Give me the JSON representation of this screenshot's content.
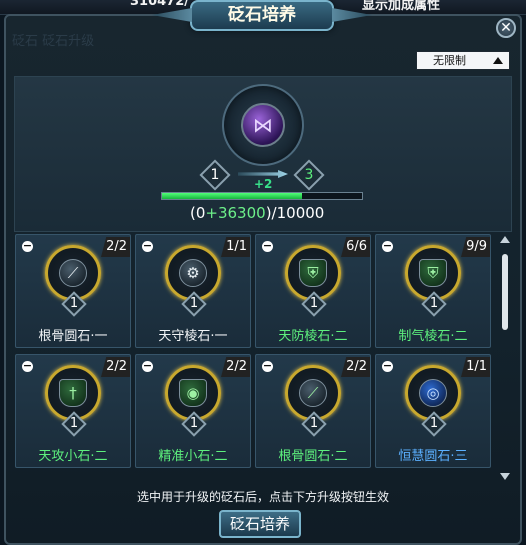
{
  "topbar": {
    "left_number": "310472/",
    "right_text": "显示加成属性"
  },
  "window": {
    "title": "砭石培养"
  },
  "tabs_hint": "砭石  砭石升级",
  "filter_dropdown": {
    "selected": "无限制"
  },
  "upgrade": {
    "current_level": "1",
    "next_level": "3",
    "level_gain": "+2",
    "progress_base": "0",
    "progress_gain": "+36300",
    "progress_max": "10000",
    "progress_fraction": 0.7
  },
  "stones": [
    {
      "name": "根骨圆石·一",
      "count": "2/2",
      "level": "1",
      "icon": "bone-icon",
      "glyph": "⟋",
      "style": "",
      "name_color": "white"
    },
    {
      "name": "天守棱石·一",
      "count": "1/1",
      "level": "1",
      "icon": "guard-icon",
      "glyph": "⚙",
      "style": "",
      "name_color": "white"
    },
    {
      "name": "天防棱石·二",
      "count": "6/6",
      "level": "1",
      "icon": "shield-icon",
      "glyph": "⛨",
      "style": "shield",
      "name_color": "green"
    },
    {
      "name": "制气棱石·二",
      "count": "9/9",
      "level": "1",
      "icon": "shield-icon",
      "glyph": "⛨",
      "style": "shield",
      "name_color": "green"
    },
    {
      "name": "天攻小石·二",
      "count": "2/2",
      "level": "1",
      "icon": "sword-icon",
      "glyph": "†",
      "style": "shield",
      "name_color": "green"
    },
    {
      "name": "精准小石·二",
      "count": "2/2",
      "level": "1",
      "icon": "target-icon",
      "glyph": "◉",
      "style": "shield",
      "name_color": "green"
    },
    {
      "name": "根骨圆石·二",
      "count": "2/2",
      "level": "1",
      "icon": "bone-icon",
      "glyph": "⟋",
      "style": "green",
      "name_color": "green"
    },
    {
      "name": "恒慧圆石·三",
      "count": "1/1",
      "level": "1",
      "icon": "wisdom-icon",
      "glyph": "◎",
      "style": "blue",
      "name_color": "blue"
    }
  ],
  "hint": "选中用于升级的砭石后，点击下方升级按钮生效",
  "action_button": "砭石培养",
  "colors": {
    "accent": "#7ab4cc",
    "gold_ring": "#c8a82e",
    "green_text": "#5df07d",
    "blue_text": "#5bb0ff"
  }
}
